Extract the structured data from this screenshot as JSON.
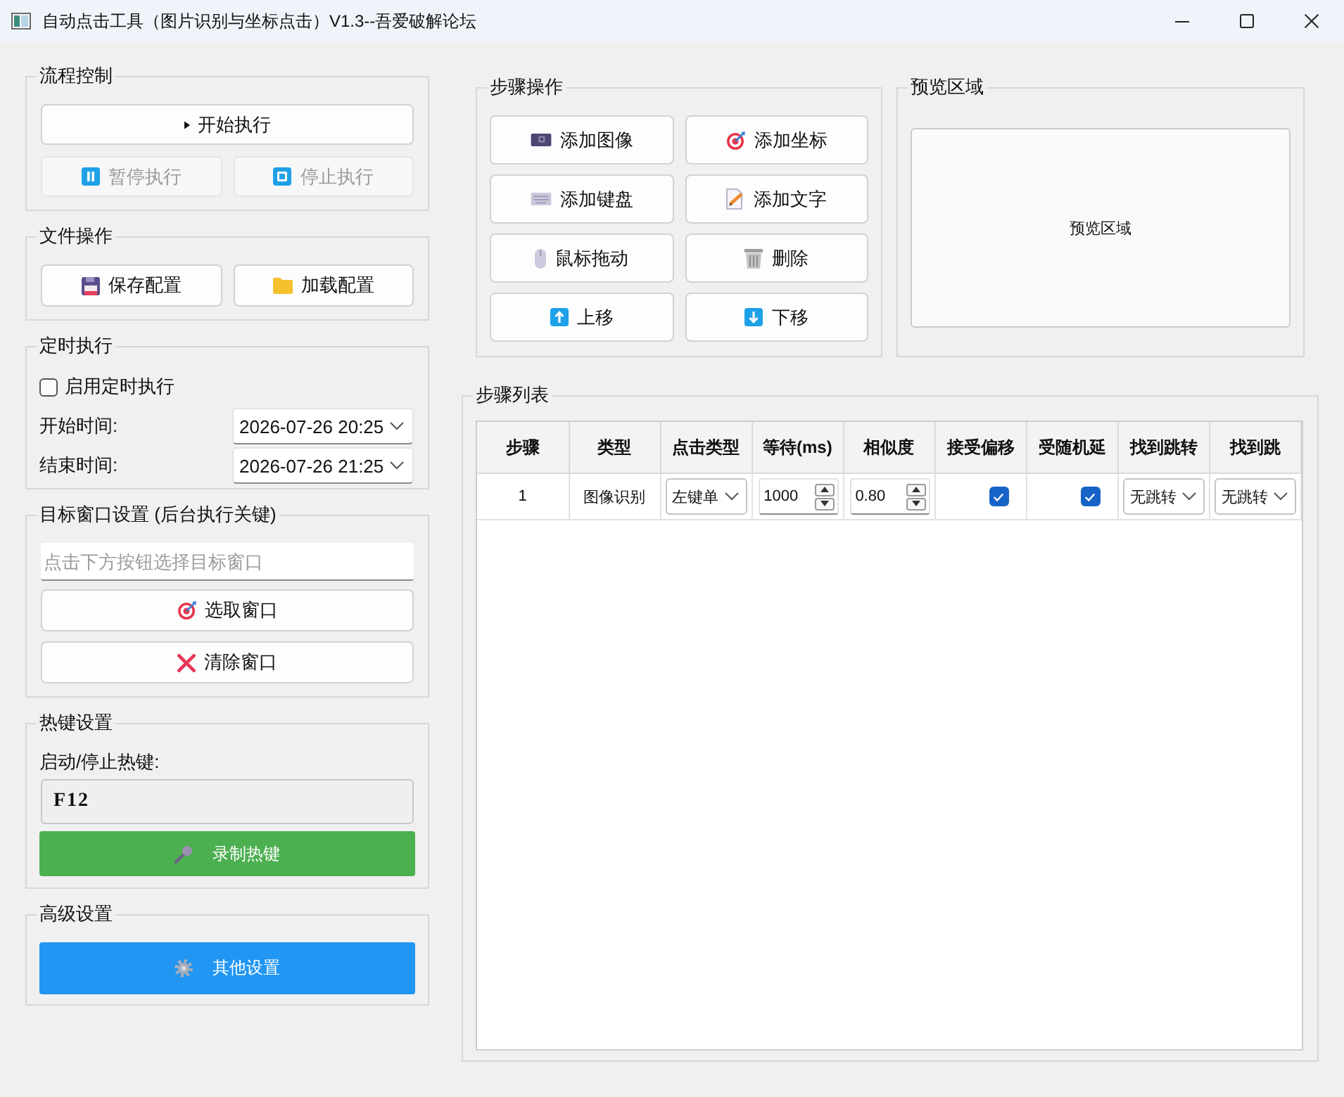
{
  "window": {
    "title": "自动点击工具（图片识别与坐标点击）V1.3--吾爱破解论坛"
  },
  "flow_control": {
    "title": "流程控制",
    "start_button": {
      "label": "开始执行",
      "disabled": false
    },
    "pause_button": {
      "label": "暂停执行",
      "disabled": true
    },
    "stop_button": {
      "label": "停止执行",
      "disabled": true
    }
  },
  "file_operations": {
    "title": "文件操作",
    "save_button": {
      "label": "保存配置"
    },
    "load_button": {
      "label": "加载配置"
    }
  },
  "schedule": {
    "title": "定时执行",
    "enable": {
      "label": "启用定时执行",
      "checked": false
    },
    "start_time": {
      "label": "开始时间:",
      "value": "2026-07-26 20:25"
    },
    "end_time": {
      "label": "结束时间:",
      "value": "2026-07-26 21:25"
    }
  },
  "target_window": {
    "title": "目标窗口设置 (后台执行关键)",
    "field": {
      "placeholder": "点击下方按钮选择目标窗口"
    },
    "select_button": {
      "label": "选取窗口"
    },
    "clear_button": {
      "label": "清除窗口"
    }
  },
  "hotkey": {
    "title": "热键设置",
    "label": "启动/停止热键:",
    "value": "F12",
    "record_button": {
      "label": "录制热键"
    }
  },
  "advanced": {
    "title": "高级设置",
    "settings_button": {
      "label": "其他设置"
    }
  },
  "step_operations": {
    "title": "步骤操作",
    "buttons": [
      {
        "label": "添加图像"
      },
      {
        "label": "添加坐标"
      },
      {
        "label": "添加键盘"
      },
      {
        "label": "添加文字"
      },
      {
        "label": "鼠标拖动"
      },
      {
        "label": "删除"
      },
      {
        "label": "上移"
      },
      {
        "label": "下移"
      }
    ]
  },
  "preview": {
    "title": "预览区域",
    "text": "预览区域"
  },
  "step_list": {
    "title": "步骤列表",
    "columns": [
      "步骤",
      "类型",
      "点击类型",
      "等待(ms)",
      "相似度",
      "接受偏移",
      "受随机延",
      "找到跳转",
      "找到跳"
    ],
    "rows": [
      {
        "cells": [
          {
            "kind": "text",
            "text": "1"
          },
          {
            "kind": "text",
            "text": "图像识别"
          },
          {
            "kind": "combo",
            "value": "左键单"
          },
          {
            "kind": "spin",
            "value": "1000"
          },
          {
            "kind": "spin",
            "value": "0.80"
          },
          {
            "kind": "checkbox",
            "checked": true
          },
          {
            "kind": "checkbox",
            "checked": true
          },
          {
            "kind": "combo",
            "value": "无跳转"
          },
          {
            "kind": "combo",
            "value": "无跳转"
          }
        ]
      }
    ]
  }
}
